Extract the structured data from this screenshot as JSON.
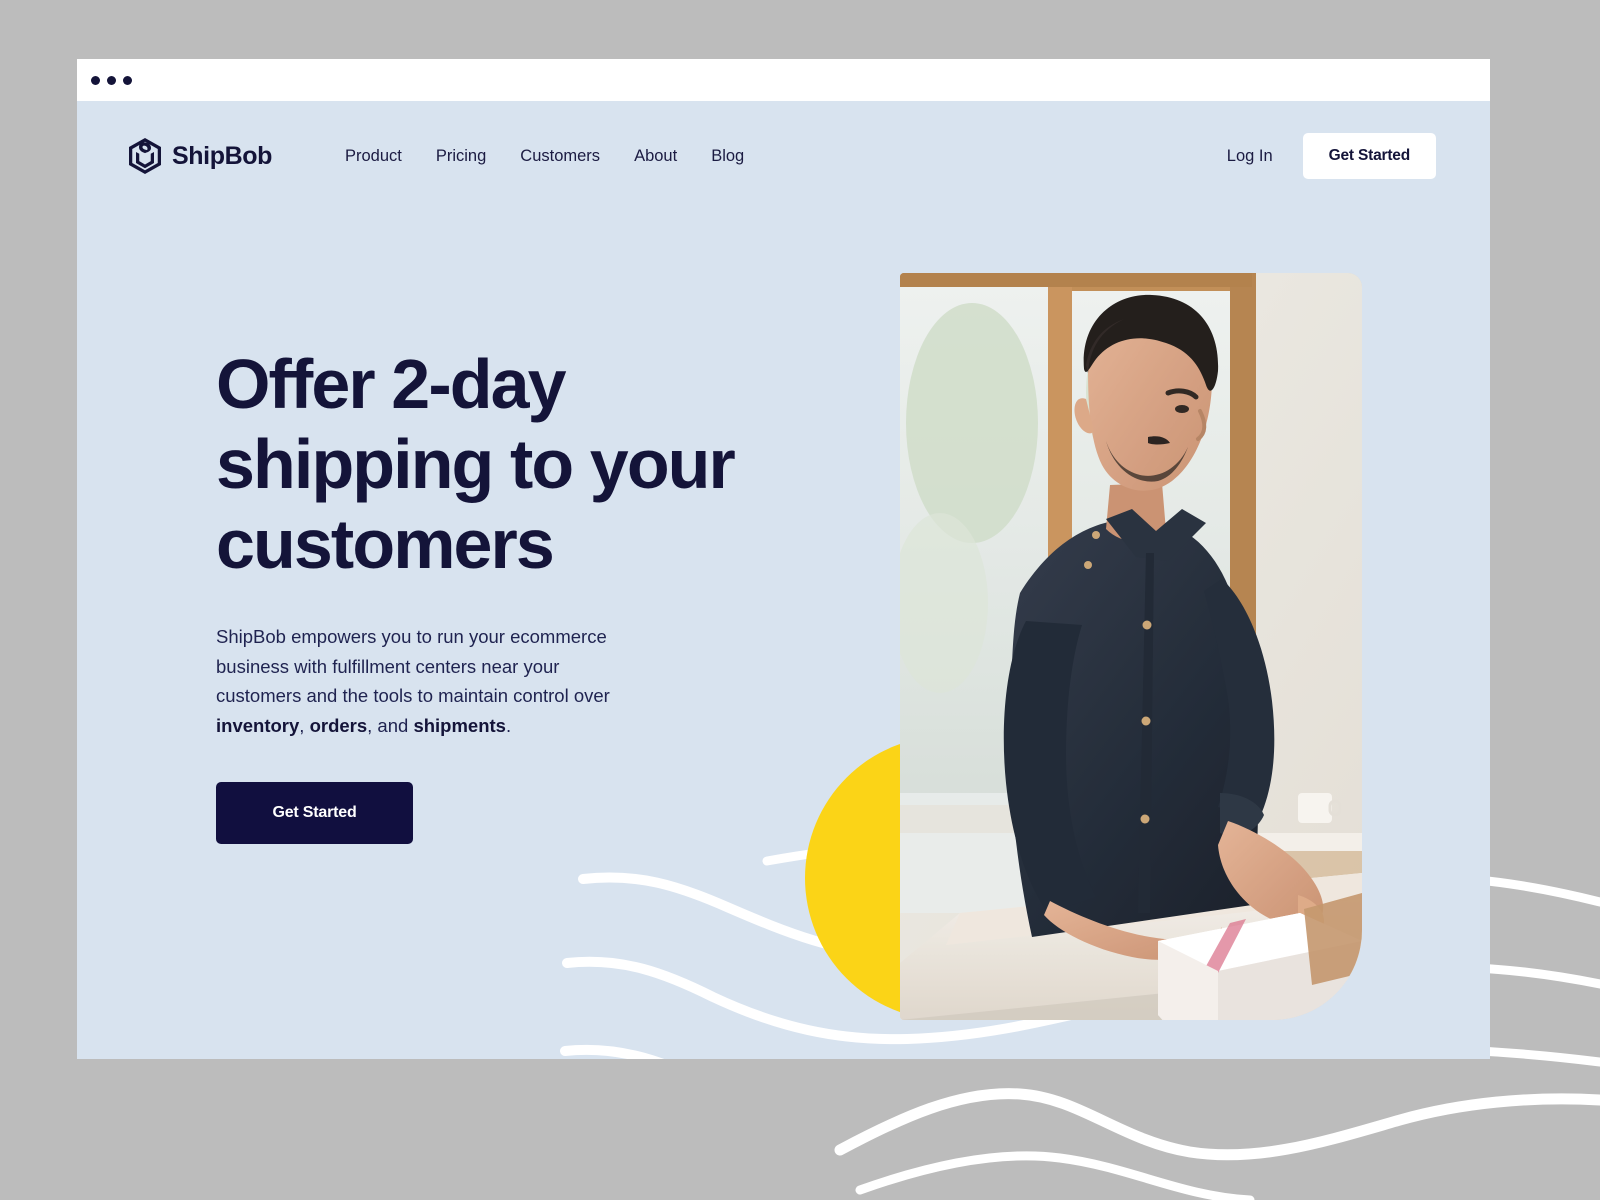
{
  "window": {
    "chrome_dots": 3,
    "dot_color": "#141439"
  },
  "theme": {
    "page_bg": "#d8e3ef",
    "canvas_bg": "#bcbcbc",
    "navy": "#141439",
    "yellow": "#fbd417",
    "white": "#ffffff"
  },
  "nav": {
    "brand": {
      "name": "ShipBob",
      "logo_icon": "shipbob-cube-logo-icon"
    },
    "links": [
      {
        "label": "Product"
      },
      {
        "label": "Pricing"
      },
      {
        "label": "Customers"
      },
      {
        "label": "About"
      },
      {
        "label": "Blog"
      }
    ],
    "login_label": "Log In",
    "cta_label": "Get Started"
  },
  "hero": {
    "headline_line1": "Offer 2-day",
    "headline_line2": "shipping to your",
    "headline_line3": "customers",
    "subcopy_part1": "ShipBob empowers you to run your ecommerce business with fulfillment centers near your customers and the tools to maintain control over ",
    "subcopy_bold1": "inventory",
    "subcopy_sep1": ", ",
    "subcopy_bold2": "orders",
    "subcopy_sep2": ", and ",
    "subcopy_bold3": "shipments",
    "subcopy_end": ".",
    "cta_label": "Get Started",
    "photo_alt": "man-packing-shipping-box-photo"
  },
  "decor": {
    "circle": "yellow-circle-shape",
    "waves": "white-brush-wave-lines"
  }
}
